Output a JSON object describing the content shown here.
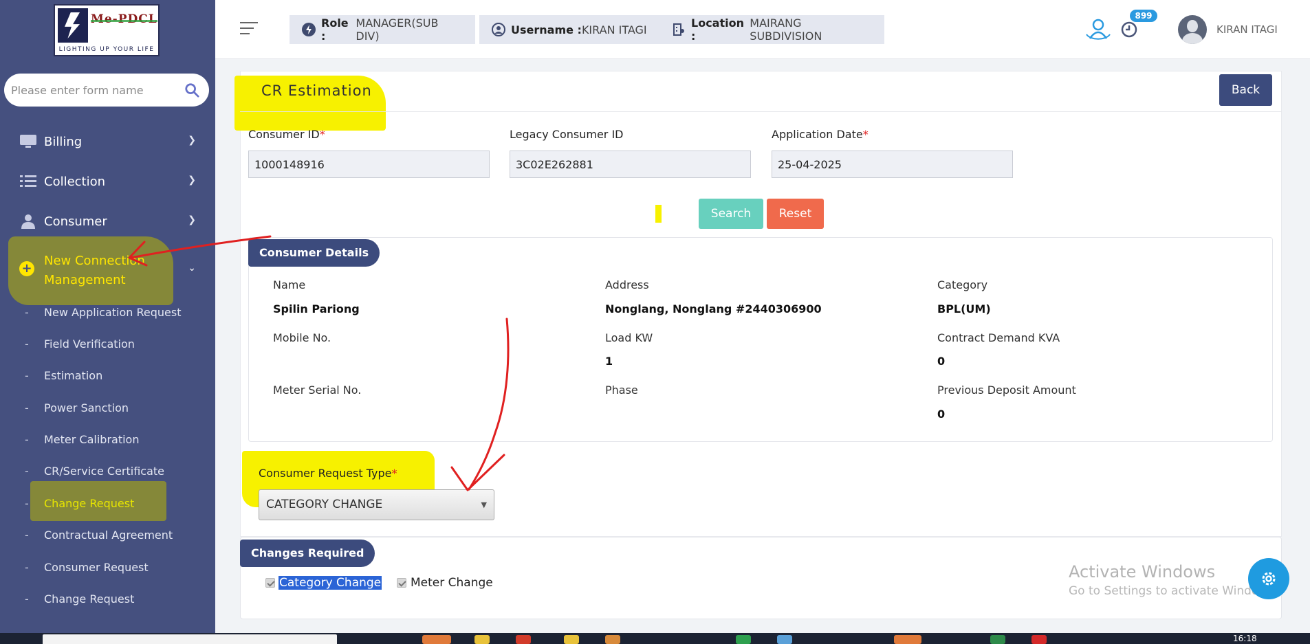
{
  "logo": {
    "brand": "Me-PDCL",
    "tagline": "LIGHTING UP YOUR LIFE"
  },
  "sidebar": {
    "search_placeholder": "Please enter form name",
    "items": [
      {
        "label": "Billing"
      },
      {
        "label": "Collection"
      },
      {
        "label": "Consumer"
      }
    ],
    "active_group": {
      "label_line1": "New Connection",
      "label_line2": "Management"
    },
    "sub_items": [
      "New Application Request",
      "Field Verification",
      "Estimation",
      "Power Sanction",
      "Meter Calibration",
      "CR/Service Certificate",
      "Change Request",
      "Contractual Agreement",
      "Consumer Request",
      "Change Request"
    ]
  },
  "header": {
    "role_label": "Role :",
    "role_value": "MANAGER(SUB DIV)",
    "username_label": "Username :",
    "username_value": "KIRAN ITAGI",
    "location_label": "Location :",
    "location_value": "MAIRANG SUBDIVISION",
    "notification_count": "899",
    "user_name": "KIRAN ITAGI"
  },
  "page": {
    "title": "CR Estimation",
    "back_label": "Back",
    "fields": {
      "consumer_id_label": "Consumer ID",
      "consumer_id_value": "1000148916",
      "legacy_id_label": "Legacy Consumer ID",
      "legacy_id_value": "3C02E262881",
      "app_date_label": "Application Date",
      "app_date_value": "25-04-2025",
      "required_mark": "*"
    },
    "search_label": "Search",
    "reset_label": "Reset",
    "consumer_details": {
      "heading": "Consumer Details",
      "name_label": "Name",
      "name_value": "Spilin Pariong",
      "address_label": "Address",
      "address_value": "Nonglang, Nonglang #2440306900",
      "category_label": "Category",
      "category_value": "BPL(UM)",
      "mobile_label": "Mobile No.",
      "mobile_value": "",
      "load_label": "Load KW",
      "load_value": "1",
      "cd_label": "Contract Demand KVA",
      "cd_value": "0",
      "meter_label": "Meter Serial No.",
      "meter_value": "",
      "phase_label": "Phase",
      "phase_value": "",
      "deposit_label": "Previous Deposit Amount",
      "deposit_value": "0"
    },
    "request_type_label": "Consumer Request Type",
    "request_type_value": "CATEGORY CHANGE",
    "changes": {
      "heading": "Changes Required",
      "opt1": "Category Change",
      "opt2": "Meter Change"
    }
  },
  "watermark": {
    "line1": "Activate Windows",
    "line2": "Go to Settings to activate Windows."
  },
  "taskbar": {
    "time": "16:18"
  },
  "colors": {
    "sidebar": "#45507f",
    "accent": "#3c4b7d",
    "highlight": "#f7f100",
    "search_btn": "#68d0be",
    "reset_btn": "#f06a4c",
    "annotation": "#e02020"
  }
}
